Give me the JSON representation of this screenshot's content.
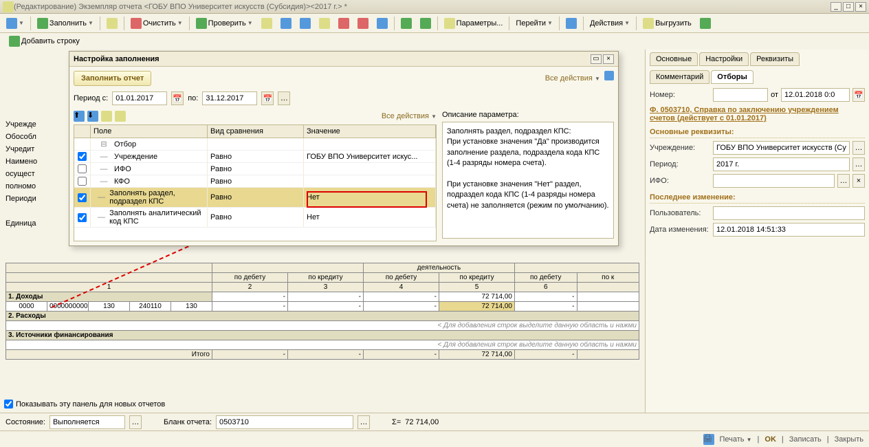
{
  "window": {
    "title": "(Редактирование) Экземпляр отчета <ГОБУ ВПО Университет искусств (Субсидия)><2017 г.> *"
  },
  "toolbar": {
    "fill": "Заполнить",
    "clear": "Очистить",
    "check": "Проверить",
    "params": "Параметры...",
    "goto": "Перейти",
    "actions": "Действия",
    "unload": "Выгрузить"
  },
  "subtoolbar": {
    "addrow": "Добавить строку"
  },
  "dialog": {
    "title": "Настройка заполнения",
    "fill_report": "Заполнить отчет",
    "all_actions": "Все действия",
    "period_from_label": "Период с:",
    "period_from": "01.01.2017",
    "period_to_label": "по:",
    "period_to": "31.12.2017",
    "desc_title": "Описание параметра:",
    "desc_text_1": "Заполнять раздел, подраздел КПС:",
    "desc_text_2": "При установке значения \"Да\" производится заполнение раздела, подраздела кода КПС (1-4 разряды номера счета).",
    "desc_text_3": "При установке значения \"Нет\" раздел, подраздел кода КПС (1-4 разряды номера счета) не заполняется (режим по умолчанию).",
    "grid": {
      "col_field": "Поле",
      "col_cmp": "Вид сравнения",
      "col_val": "Значение",
      "group": "Отбор",
      "rows": [
        {
          "chk": true,
          "field": "Учреждение",
          "cmp": "Равно",
          "val": "ГОБУ ВПО Университет искус..."
        },
        {
          "chk": false,
          "field": "ИФО",
          "cmp": "Равно",
          "val": ""
        },
        {
          "chk": false,
          "field": "КФО",
          "cmp": "Равно",
          "val": ""
        },
        {
          "chk": true,
          "field": "Заполнять раздел, подраздел КПС",
          "cmp": "Равно",
          "val": "Нет"
        },
        {
          "chk": true,
          "field": "Заполнять аналитический код КПС",
          "cmp": "Равно",
          "val": "Нет"
        }
      ]
    }
  },
  "left_labels": [
    "Учрежде",
    "Обособл",
    "Учредит",
    "Наимено",
    "осущест",
    "полномо",
    "Периоди",
    "",
    "Единица"
  ],
  "report": {
    "hdr_sub": "деятельность",
    "cols": [
      "по дебету",
      "по кредиту",
      "по дебету",
      "по кредиту",
      "по дебету",
      "по к"
    ],
    "nums": [
      "1",
      "2",
      "3",
      "4",
      "5",
      "6"
    ],
    "sections": {
      "s1": "1. Доходы",
      "s2": "2. Расходы",
      "s3": "3. Источники финансирования",
      "total": "Итого"
    },
    "row1": {
      "c1": "0000",
      "c2": "0000000000",
      "c3": "130",
      "c4": "240110",
      "c5": "130",
      "v5": "72 714,00",
      "v5b": "72 714,00"
    },
    "hint_add": "< Для добавления строк выделите данную область и нажми",
    "total_val": "72 714,00"
  },
  "status": {
    "state_label": "Состояние:",
    "state_val": "Выполняется",
    "blank_label": "Бланк отчета:",
    "blank_val": "0503710",
    "sum_label": "Σ=",
    "sum_val": "72 714,00"
  },
  "right": {
    "tabs": {
      "main": "Основные",
      "settings": "Настройки",
      "props": "Реквизиты",
      "comment": "Комментарий",
      "filters": "Отборы"
    },
    "number_label": "Номер:",
    "date_label": "от",
    "date": "12.01.2018 0:0",
    "form_link": "Ф. 0503710, Справка по заключению учреждением счетов (действует с 01.01.2017)",
    "sec_main": "Основные реквизиты:",
    "org_label": "Учреждение:",
    "org_val": "ГОБУ ВПО Университет искусств (Су",
    "period_label": "Период:",
    "period_val": "2017 г.",
    "ifo_label": "ИФО:",
    "ifo_val": "",
    "sec_change": "Последнее изменение:",
    "user_label": "Пользователь:",
    "user_val": "",
    "changed_label": "Дата изменения:",
    "changed_val": "12.01.2018 14:51:33",
    "show_panel": "Показывать эту панель для новых отчетов"
  },
  "bottom": {
    "print": "Печать",
    "ok": "OK",
    "save": "Записать",
    "close": "Закрыть"
  }
}
